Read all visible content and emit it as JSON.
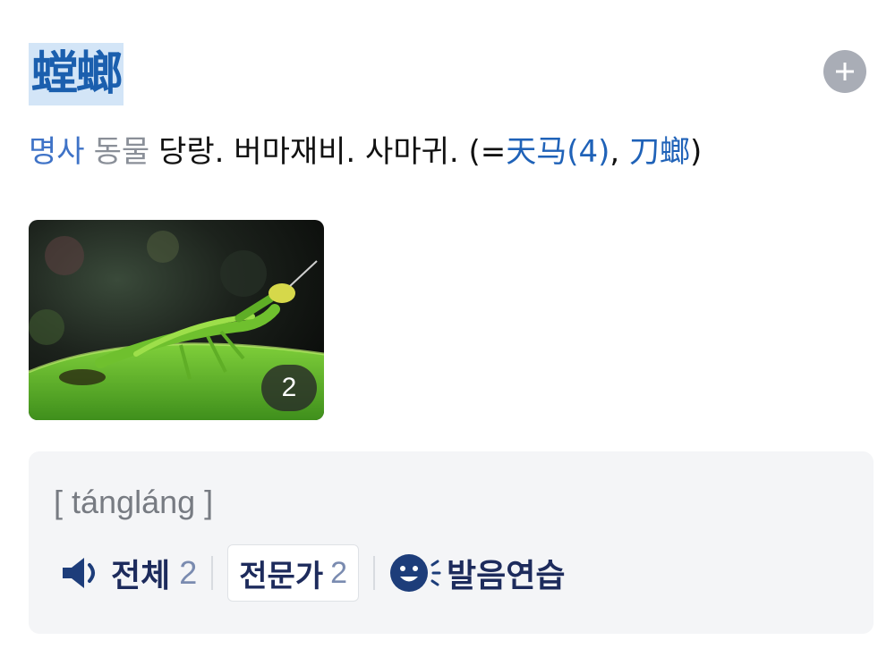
{
  "entry": {
    "headword": "螳螂",
    "part_of_speech": "명사",
    "field": "동물",
    "definition": "당랑. 버마재비. 사마귀. (=",
    "synonyms": [
      {
        "text": "天马(4)"
      },
      {
        "text": "刀螂"
      }
    ],
    "separator": ", ",
    "close": ")",
    "add_icon": "plus-circle-icon"
  },
  "image": {
    "count": "2",
    "subject": "praying mantis on leaf"
  },
  "pronunciation": {
    "pinyin": "[ tángláng ]",
    "all_label": "전체",
    "all_count": "2",
    "expert_label": "전문가",
    "expert_count": "2",
    "practice_label": "발음연습",
    "icons": [
      "speaker-icon",
      "smiley-practice-icon"
    ]
  },
  "colors": {
    "headword": "#1b5fae",
    "headword_highlight": "#d3e5f7",
    "link": "#1f62b8",
    "pos": "#3f73c7",
    "action_text": "#1d2b5c",
    "box_bg": "#f4f5f7"
  }
}
